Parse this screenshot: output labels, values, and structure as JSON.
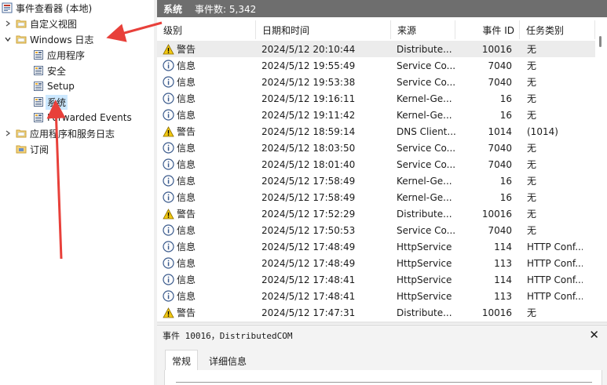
{
  "tree": {
    "root": "事件查看器 (本地)",
    "items": [
      {
        "label": "自定义视图",
        "level": 1,
        "expander": "collapsed",
        "icon": "folder-icon"
      },
      {
        "label": "Windows 日志",
        "level": 1,
        "expander": "expanded",
        "icon": "folder-icon"
      },
      {
        "label": "应用程序",
        "level": 2,
        "icon": "log-icon"
      },
      {
        "label": "安全",
        "level": 2,
        "icon": "log-icon"
      },
      {
        "label": "Setup",
        "level": 2,
        "icon": "log-icon"
      },
      {
        "label": "系统",
        "level": 2,
        "icon": "log-icon",
        "selected": true
      },
      {
        "label": "Forwarded Events",
        "level": 2,
        "icon": "log-icon"
      },
      {
        "label": "应用程序和服务日志",
        "level": 1,
        "expander": "collapsed",
        "icon": "folder-icon"
      },
      {
        "label": "订阅",
        "level": 1,
        "icon": "subscription-icon"
      }
    ]
  },
  "panel": {
    "title": "系统",
    "count": "事件数: 5,342"
  },
  "columns": {
    "level": "级别",
    "date": "日期和时间",
    "source": "来源",
    "event_id": "事件 ID",
    "task": "任务类别"
  },
  "events": [
    {
      "level": "警告",
      "type": "warning",
      "date": "2024/5/12 20:10:44",
      "source": "Distribute...",
      "id": "10016",
      "task": "无"
    },
    {
      "level": "信息",
      "type": "info",
      "date": "2024/5/12 19:55:49",
      "source": "Service Co...",
      "id": "7040",
      "task": "无"
    },
    {
      "level": "信息",
      "type": "info",
      "date": "2024/5/12 19:53:38",
      "source": "Service Co...",
      "id": "7040",
      "task": "无"
    },
    {
      "level": "信息",
      "type": "info",
      "date": "2024/5/12 19:16:11",
      "source": "Kernel-Ge...",
      "id": "16",
      "task": "无"
    },
    {
      "level": "信息",
      "type": "info",
      "date": "2024/5/12 19:11:42",
      "source": "Kernel-Ge...",
      "id": "16",
      "task": "无"
    },
    {
      "level": "警告",
      "type": "warning",
      "date": "2024/5/12 18:59:14",
      "source": "DNS Client...",
      "id": "1014",
      "task": "(1014)"
    },
    {
      "level": "信息",
      "type": "info",
      "date": "2024/5/12 18:03:50",
      "source": "Service Co...",
      "id": "7040",
      "task": "无"
    },
    {
      "level": "信息",
      "type": "info",
      "date": "2024/5/12 18:01:40",
      "source": "Service Co...",
      "id": "7040",
      "task": "无"
    },
    {
      "level": "信息",
      "type": "info",
      "date": "2024/5/12 17:58:49",
      "source": "Kernel-Ge...",
      "id": "16",
      "task": "无"
    },
    {
      "level": "信息",
      "type": "info",
      "date": "2024/5/12 17:58:49",
      "source": "Kernel-Ge...",
      "id": "16",
      "task": "无"
    },
    {
      "level": "警告",
      "type": "warning",
      "date": "2024/5/12 17:52:29",
      "source": "Distribute...",
      "id": "10016",
      "task": "无"
    },
    {
      "level": "信息",
      "type": "info",
      "date": "2024/5/12 17:50:53",
      "source": "Service Co...",
      "id": "7040",
      "task": "无"
    },
    {
      "level": "信息",
      "type": "info",
      "date": "2024/5/12 17:48:49",
      "source": "HttpService",
      "id": "114",
      "task": "HTTP Conf..."
    },
    {
      "level": "信息",
      "type": "info",
      "date": "2024/5/12 17:48:49",
      "source": "HttpService",
      "id": "113",
      "task": "HTTP Conf..."
    },
    {
      "level": "信息",
      "type": "info",
      "date": "2024/5/12 17:48:41",
      "source": "HttpService",
      "id": "114",
      "task": "HTTP Conf..."
    },
    {
      "level": "信息",
      "type": "info",
      "date": "2024/5/12 17:48:41",
      "source": "HttpService",
      "id": "113",
      "task": "HTTP Conf..."
    },
    {
      "level": "警告",
      "type": "warning",
      "date": "2024/5/12 17:47:31",
      "source": "Distribute...",
      "id": "10016",
      "task": "无"
    }
  ],
  "detail": {
    "title": "事件 10016，DistributedCOM",
    "close": "✕",
    "tabs": [
      "常规",
      "详细信息"
    ]
  },
  "colors": {
    "annotation_arrow": "#e8403a",
    "title_bar": "#6e6e6e",
    "selected": "#cce8ff",
    "warning": "#f2c811",
    "info": "#3a5a8c"
  }
}
